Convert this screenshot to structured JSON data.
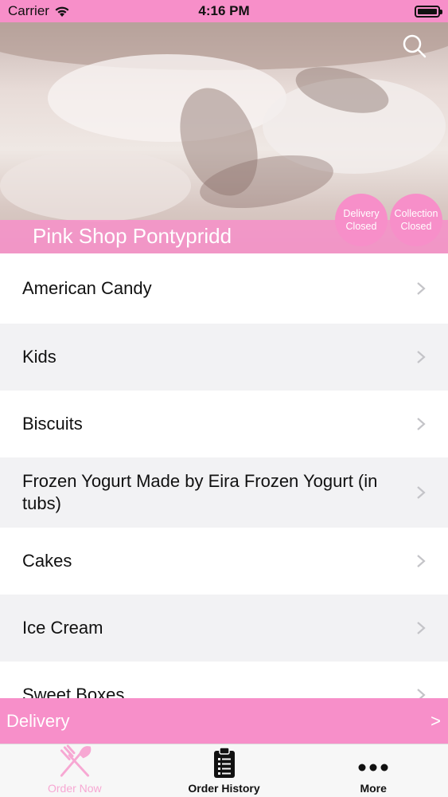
{
  "status_bar": {
    "carrier": "Carrier",
    "time": "4:16 PM"
  },
  "hero": {
    "shop_name": "Pink Shop Pontypridd",
    "delivery_status": {
      "line1": "Delivery",
      "line2": "Closed"
    },
    "collection_status": {
      "line1": "Collection",
      "line2": "Closed"
    }
  },
  "categories": [
    {
      "label": "American Candy"
    },
    {
      "label": "Kids"
    },
    {
      "label": "Biscuits"
    },
    {
      "label": "Frozen Yogurt Made by Eira Frozen Yogurt (in tubs)"
    },
    {
      "label": "Cakes"
    },
    {
      "label": "Ice Cream"
    },
    {
      "label": "Sweet Boxes"
    }
  ],
  "delivery_bar": {
    "label": "Delivery",
    "arrow": ">"
  },
  "tabs": [
    {
      "label": "Order Now",
      "icon": "fork-knife-icon",
      "active": true
    },
    {
      "label": "Order History",
      "icon": "clipboard-icon",
      "active": false
    },
    {
      "label": "More",
      "icon": "more-dots-icon",
      "active": false
    }
  ],
  "colors": {
    "brand_pink": "#f78fc9",
    "active_tab": "#f7a8d3"
  }
}
